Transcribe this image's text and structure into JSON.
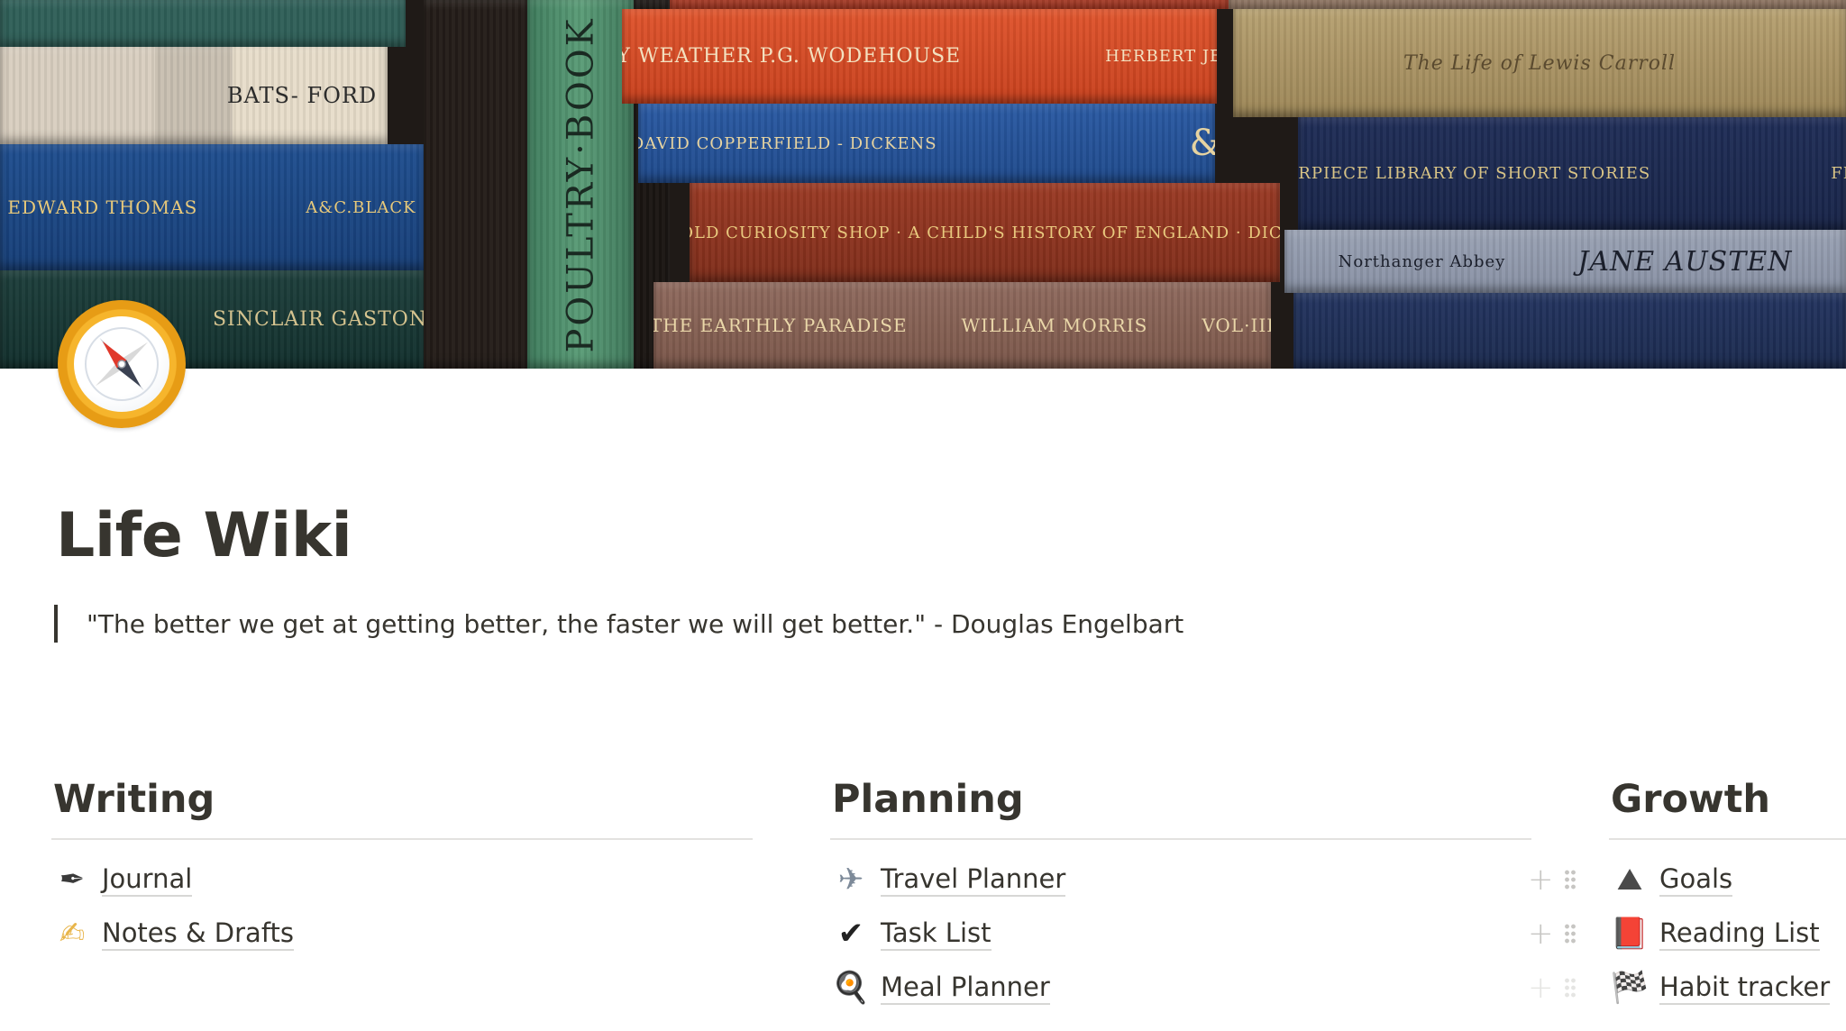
{
  "page": {
    "title": "Life Wiki",
    "quote": "\"The better we get at getting better, the faster we will get better.\" - Douglas Engelbart",
    "icon": "compass-icon"
  },
  "cover": {
    "description": "bookshelf",
    "book_titles": {
      "batsford": "BATS- FORD",
      "thomas": "EDWARD THOMAS",
      "black": "A&C.BLACK",
      "sinclair": "SINCLAIR GASTON",
      "poultry": "POULTRY·BOOK",
      "wodehouse": "HEAVY WEATHER  P.G. WODEHOUSE",
      "jenkins": "HERBERT JENKINS",
      "copperfield": "DAVID COPPERFIELD - DICKENS",
      "curiosity": "THE OLD CURIOSITY SHOP · A CHILD'S HISTORY OF ENGLAND · DICKENS",
      "paradise": "THE EARTHLY PARADISE",
      "morris": "WILLIAM MORRIS",
      "vol": "VOL·III",
      "carroll": "The Life of Lewis Carroll",
      "masterpiece": "MASTERPIECE LIBRARY OF SHORT STORIES",
      "french": "FRENCH",
      "northanger": "Northanger Abbey",
      "austen": "JANE AUSTEN"
    }
  },
  "columns": [
    {
      "heading": "Writing",
      "items": [
        {
          "label": "Journal",
          "icon": "fountain-pen-icon",
          "glyph": "✒"
        },
        {
          "label": "Notes & Drafts",
          "icon": "writing-hand-icon",
          "glyph": "✍"
        }
      ]
    },
    {
      "heading": "Planning",
      "items": [
        {
          "label": "Travel Planner",
          "icon": "airplane-icon",
          "glyph": "✈"
        },
        {
          "label": "Task List",
          "icon": "check-mark-icon",
          "glyph": "✔"
        },
        {
          "label": "Meal Planner",
          "icon": "frying-pan-icon",
          "glyph": "🍳"
        }
      ]
    },
    {
      "heading": "Growth",
      "items": [
        {
          "label": "Goals",
          "icon": "mountain-icon",
          "glyph": "⛰"
        },
        {
          "label": "Reading List",
          "icon": "red-book-icon",
          "glyph": "📕"
        },
        {
          "label": "Habit tracker",
          "icon": "checkered-flag-icon",
          "glyph": "🏁"
        }
      ]
    }
  ],
  "colors": {
    "text": "#37352f",
    "divider": "#e3e2e0",
    "compass_ring": "#f6b52c"
  }
}
